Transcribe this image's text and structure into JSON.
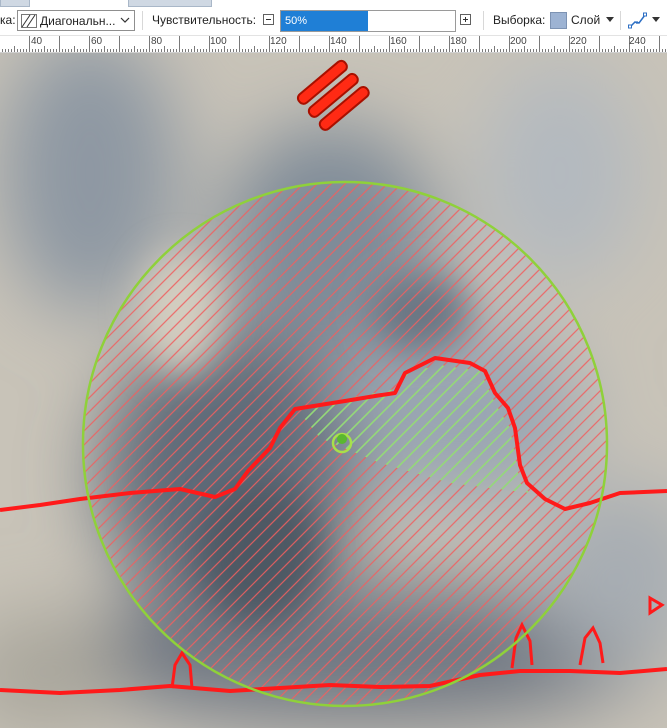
{
  "toolbar": {
    "fill_label": "ка:",
    "fill_style_value": "Диагональн...",
    "sensitivity_label": "Чувствительность:",
    "sensitivity_value": "50%",
    "sensitivity_fraction": 0.5,
    "selection_label": "Выборка:",
    "selection_value": "Слой",
    "selection_swatch_color": "#9db3d3"
  },
  "ruler": {
    "ticks": [
      "40",
      "60",
      "80",
      "100",
      "120",
      "140",
      "160",
      "180",
      "200",
      "220",
      "240"
    ]
  },
  "colors": {
    "selection_outline": "#ff0000",
    "brush_circle": "#8fd13a",
    "hatch_red": "#f06060",
    "hatch_green": "#8ee07a"
  },
  "icons": [
    "diagonal-hatch-icon",
    "chevron-down-icon",
    "minus-icon",
    "plus-icon",
    "dropdown-arrow-icon",
    "magic-path-icon"
  ]
}
